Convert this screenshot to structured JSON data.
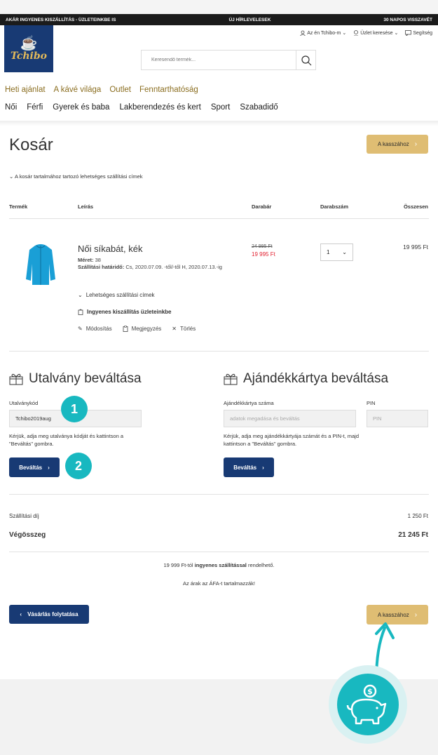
{
  "topbar": {
    "left": "AKÁR INGYENES KISZÁLLÍTÁS - ÜZLETEINKBE IS",
    "center": "ÚJ HÍRLEVELESEK",
    "right": "30 NAPOS VISSZAVÉT"
  },
  "logo": {
    "text": "Tchibo"
  },
  "utility": {
    "account": "Az én Tchibo-m",
    "store": "Üzlet keresése",
    "help": "Segítség"
  },
  "search": {
    "placeholder": "Keresendő termék..."
  },
  "nav1": [
    "Heti ajánlat",
    "A kávé világa",
    "Outlet",
    "Fenntarthatóság"
  ],
  "nav2": [
    "Női",
    "Férfi",
    "Gyerek és baba",
    "Lakberendezés és kert",
    "Sport",
    "Szabadidő"
  ],
  "cart": {
    "title": "Kosár",
    "checkout_label": "A kasszához",
    "shipping_addresses": "A kosár tartalmához tartozó lehetséges szállítási címek",
    "columns": {
      "product": "Termék",
      "description": "Leírás",
      "unit_price": "Darabár",
      "quantity": "Darabszám",
      "total": "Összesen"
    },
    "item": {
      "name": "Női síkabát, kék",
      "size_label": "Méret:",
      "size": "38",
      "deadline_label": "Szállítási határidő:",
      "deadline": "Cs, 2020.07.09. -től/-től H, 2020.07.13.-ig",
      "old_price": "24 995 Ft",
      "price": "19 995 Ft",
      "qty": "1",
      "total": "19 995 Ft",
      "addresses": "Lehetséges szállítási címek",
      "free_shipping": "Ingyenes kiszállítás üzleteinkbe",
      "edit": "Módosítás",
      "note": "Megjegyzés",
      "delete": "Törlés"
    }
  },
  "voucher": {
    "title": "Utalvány beváltása",
    "code_label": "Utalványkód",
    "code_value": "Tchibo2019aug",
    "hint": "Kérjük, adja meg utalványa kódját és kattintson a \"Beváltás\" gombra.",
    "button": "Beváltás"
  },
  "giftcard": {
    "title": "Ajándékkártya beváltása",
    "number_label": "Ajándékkártya száma",
    "number_placeholder": "adatok megadása és beváltás",
    "pin_label": "PIN",
    "pin_placeholder": "PIN",
    "hint": "Kérjük, adja meg ajándékkártyája számát és a PIN-t, majd kattintson a \"Beváltás\" gombra.",
    "button": "Beváltás"
  },
  "summary": {
    "shipping_label": "Szállítási díj",
    "shipping_value": "1 250 Ft",
    "total_label": "Végösszeg",
    "total_value": "21 245 Ft"
  },
  "notes": {
    "free_pre": "19 999 Ft-tól",
    "free_bold": "ingyenes szállítással",
    "free_post": "rendelhető.",
    "vat": "Az árak az ÁFA-t tartalmazzák!"
  },
  "continue_label": "Vásárlás folytatása",
  "badges": [
    "1",
    "2"
  ],
  "colors": {
    "brand_navy": "#183a74",
    "gold": "#dfbd73",
    "accent_teal": "#18b8c0",
    "sale_red": "#e2202f"
  }
}
